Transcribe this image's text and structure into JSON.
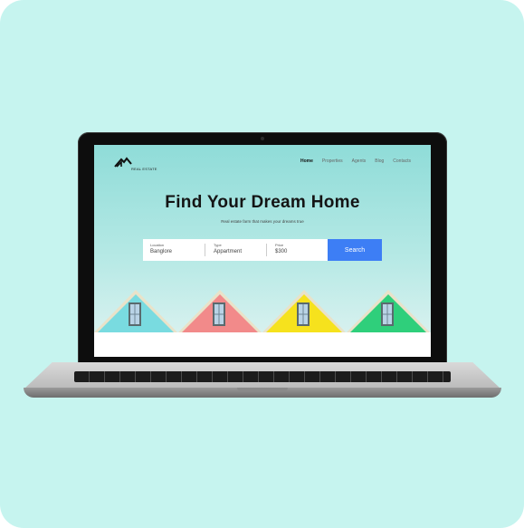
{
  "site": {
    "logo_text": "REAL ESTATE",
    "nav": [
      "Home",
      "Properties",
      "Agents",
      "Blog",
      "Contacts"
    ],
    "active_nav": "Home"
  },
  "hero": {
    "title": "Find Your Dream Home",
    "subtitle": "Real estate farm that makes your dreams true"
  },
  "search": {
    "location_label": "Location",
    "location_value": "Banglore",
    "type_label": "Type",
    "type_value": "Appartment",
    "price_label": "Price",
    "price_value": "$300",
    "button_label": "Search"
  },
  "colors": {
    "background": "#c6f4ef",
    "search_button": "#3d7ef5",
    "house_colors": [
      "#79dbe0",
      "#f28a8a",
      "#f6e21d",
      "#2fcf7b"
    ]
  }
}
